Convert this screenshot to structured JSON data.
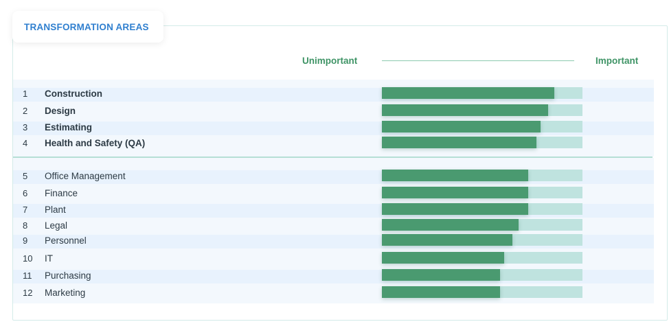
{
  "header": {
    "tab_label": "TRANSFORMATION AREAS"
  },
  "scale": {
    "left_label": "Unimportant",
    "right_label": "Important"
  },
  "colors": {
    "bar": "#4a9a70",
    "track": "#bfe3df",
    "accent": "#2f7fcf",
    "scale_text": "#3f9466"
  },
  "chart_data": {
    "type": "bar",
    "orientation": "horizontal",
    "xlim": [
      0,
      1
    ],
    "categories": [
      "Construction",
      "Design",
      "Estimating",
      "Health and Safety (QA)",
      "Office Management",
      "Finance",
      "Plant",
      "Legal",
      "Personnel",
      "IT",
      "Purchasing",
      "Marketing"
    ],
    "ranks": [
      "1",
      "2",
      "3",
      "4",
      "5",
      "6",
      "7",
      "8",
      "9",
      "10",
      "11",
      "12"
    ],
    "values": [
      0.86,
      0.83,
      0.79,
      0.77,
      0.73,
      0.73,
      0.73,
      0.68,
      0.65,
      0.61,
      0.59,
      0.59
    ],
    "highlighted_count": 4
  }
}
